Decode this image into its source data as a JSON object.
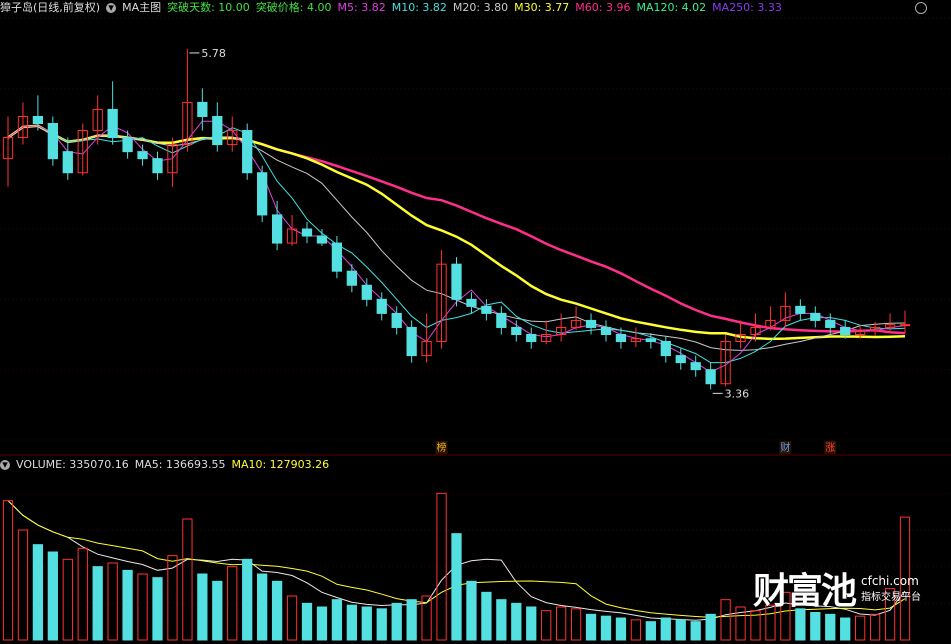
{
  "main_legend": {
    "stock": "獐子岛(日线,前复权)",
    "ma_label": "MA主图",
    "breakout_days": "突破天数: 10.00",
    "breakout_price": "突破价格: 4.00",
    "m5": "M5: 3.82",
    "m10": "M10: 3.82",
    "m20": "M20: 3.80",
    "m30": "M30: 3.77",
    "m60": "M60: 3.96",
    "ma120": "MA120: 4.02",
    "ma250": "MA250: 3.33"
  },
  "vol_legend": {
    "volume": "VOLUME: 335070.16",
    "ma5": "MA5: 136693.55",
    "ma10": "MA10: 127903.26"
  },
  "annotations": {
    "high": "5.78",
    "low": "3.36",
    "marks": [
      "榜",
      "财",
      "涨"
    ]
  },
  "watermark": {
    "logo": "财富池",
    "domain": "cfchi.com",
    "slogan": "指标交易平台"
  },
  "colors": {
    "up": "#ff3232",
    "down": "#54e0e0",
    "m5": "#e040e0",
    "m10": "#40e0e0",
    "m20": "#c8c8c8",
    "m30": "#ffff30",
    "m60": "#ff2d8c",
    "ma120": "#3cf08c",
    "ma250": "#8a3cf0"
  },
  "chart_data": {
    "type": "candlestick",
    "ylim": [
      3.0,
      6.0
    ],
    "high_point": 5.78,
    "low_point": 3.36,
    "candles": [
      [
        5.0,
        5.15,
        5.3,
        4.8
      ],
      [
        5.15,
        5.3,
        5.4,
        5.1
      ],
      [
        5.3,
        5.25,
        5.45,
        5.2
      ],
      [
        5.25,
        5.0,
        5.3,
        4.95
      ],
      [
        5.05,
        4.9,
        5.15,
        4.85
      ],
      [
        4.9,
        5.2,
        5.25,
        4.88
      ],
      [
        5.2,
        5.35,
        5.45,
        5.1
      ],
      [
        5.35,
        5.15,
        5.55,
        5.1
      ],
      [
        5.15,
        5.05,
        5.2,
        5.0
      ],
      [
        5.05,
        5.0,
        5.1,
        4.95
      ],
      [
        5.0,
        4.9,
        5.05,
        4.85
      ],
      [
        4.9,
        5.1,
        5.15,
        4.8
      ],
      [
        5.1,
        5.4,
        5.78,
        5.05
      ],
      [
        5.4,
        5.3,
        5.5,
        5.2
      ],
      [
        5.3,
        5.1,
        5.4,
        5.05
      ],
      [
        5.1,
        5.2,
        5.3,
        5.05
      ],
      [
        5.2,
        4.9,
        5.25,
        4.85
      ],
      [
        4.9,
        4.6,
        4.95,
        4.55
      ],
      [
        4.6,
        4.4,
        4.7,
        4.35
      ],
      [
        4.4,
        4.5,
        4.6,
        4.38
      ],
      [
        4.5,
        4.45,
        4.55,
        4.4
      ],
      [
        4.45,
        4.4,
        4.5,
        4.38
      ],
      [
        4.4,
        4.2,
        4.45,
        4.15
      ],
      [
        4.2,
        4.1,
        4.25,
        4.05
      ],
      [
        4.1,
        4.0,
        4.15,
        3.95
      ],
      [
        4.0,
        3.9,
        4.05,
        3.85
      ],
      [
        3.9,
        3.8,
        3.95,
        3.75
      ],
      [
        3.8,
        3.6,
        3.85,
        3.55
      ],
      [
        3.6,
        3.7,
        3.9,
        3.55
      ],
      [
        3.7,
        4.25,
        4.35,
        3.65
      ],
      [
        4.25,
        4.0,
        4.3,
        3.95
      ],
      [
        4.0,
        3.95,
        4.05,
        3.9
      ],
      [
        3.95,
        3.9,
        4.0,
        3.85
      ],
      [
        3.9,
        3.8,
        3.95,
        3.75
      ],
      [
        3.8,
        3.75,
        3.85,
        3.7
      ],
      [
        3.75,
        3.7,
        3.8,
        3.65
      ],
      [
        3.7,
        3.75,
        3.85,
        3.68
      ],
      [
        3.75,
        3.8,
        3.9,
        3.7
      ],
      [
        3.8,
        3.85,
        3.95,
        3.78
      ],
      [
        3.85,
        3.8,
        3.9,
        3.75
      ],
      [
        3.8,
        3.75,
        3.85,
        3.7
      ],
      [
        3.75,
        3.7,
        3.8,
        3.65
      ],
      [
        3.7,
        3.72,
        3.8,
        3.66
      ],
      [
        3.72,
        3.7,
        3.76,
        3.65
      ],
      [
        3.7,
        3.6,
        3.74,
        3.55
      ],
      [
        3.6,
        3.55,
        3.65,
        3.5
      ],
      [
        3.55,
        3.5,
        3.6,
        3.45
      ],
      [
        3.5,
        3.4,
        3.55,
        3.36
      ],
      [
        3.4,
        3.7,
        3.75,
        3.38
      ],
      [
        3.7,
        3.75,
        3.85,
        3.65
      ],
      [
        3.75,
        3.8,
        3.9,
        3.7
      ],
      [
        3.8,
        3.85,
        3.95,
        3.78
      ],
      [
        3.85,
        3.95,
        4.05,
        3.8
      ],
      [
        3.95,
        3.9,
        4.0,
        3.85
      ],
      [
        3.9,
        3.85,
        3.95,
        3.8
      ],
      [
        3.85,
        3.8,
        3.9,
        3.75
      ],
      [
        3.8,
        3.75,
        3.85,
        3.72
      ],
      [
        3.75,
        3.78,
        3.82,
        3.72
      ],
      [
        3.78,
        3.8,
        3.84,
        3.74
      ],
      [
        3.8,
        3.82,
        3.9,
        3.76
      ],
      [
        3.82,
        3.82,
        3.92,
        3.76
      ]
    ],
    "vol_ylim": [
      0,
      450000
    ],
    "volume": [
      {
        "v": 380000,
        "up": true
      },
      {
        "v": 300000,
        "up": true
      },
      {
        "v": 260000,
        "up": false
      },
      {
        "v": 240000,
        "up": false
      },
      {
        "v": 220000,
        "up": true
      },
      {
        "v": 250000,
        "up": true
      },
      {
        "v": 200000,
        "up": false
      },
      {
        "v": 210000,
        "up": true
      },
      {
        "v": 190000,
        "up": false
      },
      {
        "v": 180000,
        "up": true
      },
      {
        "v": 170000,
        "up": false
      },
      {
        "v": 230000,
        "up": true
      },
      {
        "v": 330000,
        "up": true
      },
      {
        "v": 180000,
        "up": false
      },
      {
        "v": 160000,
        "up": false
      },
      {
        "v": 200000,
        "up": true
      },
      {
        "v": 220000,
        "up": false
      },
      {
        "v": 180000,
        "up": false
      },
      {
        "v": 160000,
        "up": false
      },
      {
        "v": 120000,
        "up": true
      },
      {
        "v": 100000,
        "up": false
      },
      {
        "v": 90000,
        "up": false
      },
      {
        "v": 110000,
        "up": false
      },
      {
        "v": 95000,
        "up": false
      },
      {
        "v": 90000,
        "up": false
      },
      {
        "v": 85000,
        "up": false
      },
      {
        "v": 100000,
        "up": false
      },
      {
        "v": 110000,
        "up": false
      },
      {
        "v": 120000,
        "up": true
      },
      {
        "v": 400000,
        "up": true
      },
      {
        "v": 290000,
        "up": false
      },
      {
        "v": 160000,
        "up": false
      },
      {
        "v": 130000,
        "up": false
      },
      {
        "v": 110000,
        "up": false
      },
      {
        "v": 100000,
        "up": false
      },
      {
        "v": 90000,
        "up": false
      },
      {
        "v": 80000,
        "up": true
      },
      {
        "v": 90000,
        "up": true
      },
      {
        "v": 85000,
        "up": true
      },
      {
        "v": 70000,
        "up": false
      },
      {
        "v": 65000,
        "up": false
      },
      {
        "v": 60000,
        "up": false
      },
      {
        "v": 55000,
        "up": true
      },
      {
        "v": 50000,
        "up": false
      },
      {
        "v": 60000,
        "up": false
      },
      {
        "v": 55000,
        "up": false
      },
      {
        "v": 50000,
        "up": false
      },
      {
        "v": 70000,
        "up": false
      },
      {
        "v": 110000,
        "up": true
      },
      {
        "v": 90000,
        "up": true
      },
      {
        "v": 80000,
        "up": true
      },
      {
        "v": 95000,
        "up": true
      },
      {
        "v": 130000,
        "up": true
      },
      {
        "v": 85000,
        "up": false
      },
      {
        "v": 75000,
        "up": false
      },
      {
        "v": 70000,
        "up": false
      },
      {
        "v": 60000,
        "up": false
      },
      {
        "v": 65000,
        "up": true
      },
      {
        "v": 70000,
        "up": true
      },
      {
        "v": 140000,
        "up": true
      },
      {
        "v": 335070,
        "up": true
      }
    ]
  }
}
